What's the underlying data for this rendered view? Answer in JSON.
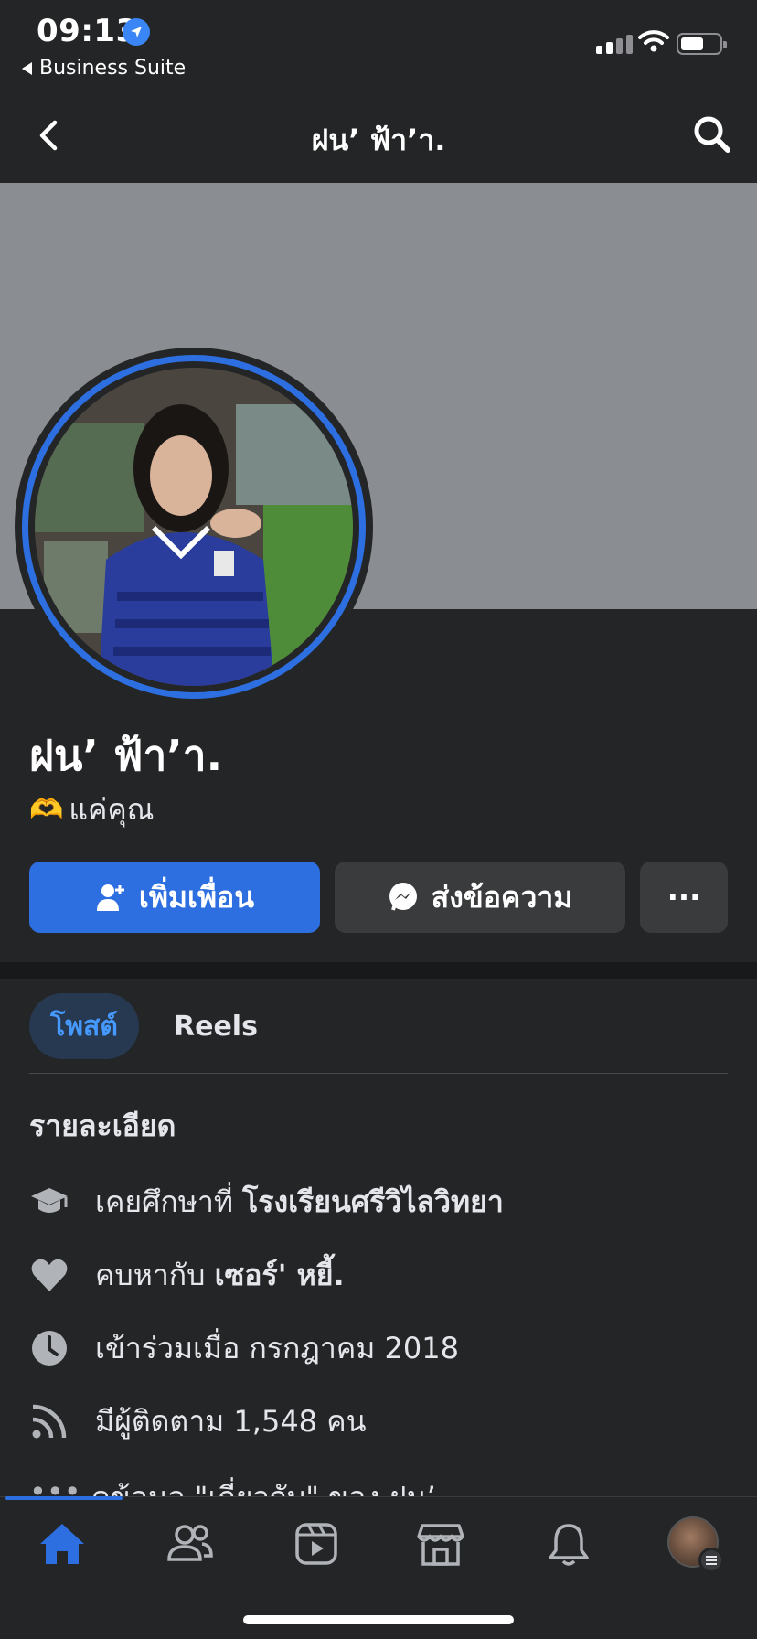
{
  "status_bar": {
    "time": "09:13",
    "back_app": "Business Suite"
  },
  "nav": {
    "title": "ฝน’ ฟ้า’า."
  },
  "profile": {
    "name": "ฝน’ ฟ้า’า.",
    "bio_emoji": "🫶",
    "bio_text": "แค่คุณ"
  },
  "actions": {
    "add_friend": "เพิ่มเพื่อน",
    "message": "ส่งข้อความ",
    "more": "···"
  },
  "tabs": {
    "posts": "โพสต์",
    "reels": "Reels"
  },
  "details": {
    "title": "รายละเอียด",
    "education_prefix": "เคยศึกษาที่",
    "education_value": "โรงเรียนศรีวิไลวิทยา",
    "relationship_prefix": "คบหากับ",
    "relationship_value": "เซอร์' หยี้.",
    "joined": "เข้าร่วมเมื่อ กรกฎาคม  2018",
    "followers": "มีผู้ติดตาม 1,548 คน",
    "about_partial": "ดูข้อมูล \"เกี่ยวกับ\" ของ ฝน’"
  },
  "icons": {
    "location": "location-arrow-icon",
    "education": "graduation-cap-icon",
    "relationship": "heart-icon",
    "joined": "clock-icon",
    "followers": "rss-icon",
    "tab_home": "home-icon",
    "tab_friends": "friends-icon",
    "tab_video": "video-icon",
    "tab_marketplace": "marketplace-icon",
    "tab_notifications": "bell-icon"
  },
  "colors": {
    "accent": "#2d6fe0",
    "background": "#242526",
    "cover": "#8a8d91"
  }
}
